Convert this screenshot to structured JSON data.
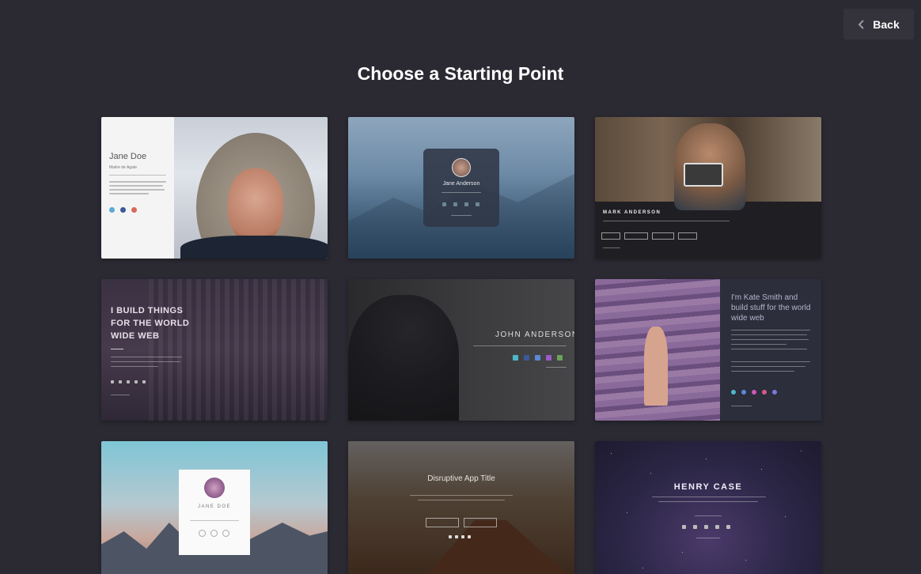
{
  "header": {
    "back_label": "Back",
    "title": "Choose a Starting Point"
  },
  "templates": {
    "t1": {
      "name": "Jane Doe",
      "subtitle": "Maitre de Agate"
    },
    "t2": {
      "name": "Jane Anderson"
    },
    "t3": {
      "name": "MARK ANDERSON"
    },
    "t4": {
      "headline_1": "I BUILD THINGS",
      "headline_2": "FOR THE WORLD",
      "headline_3": "WIDE WEB"
    },
    "t5": {
      "name": "JOHN ANDERSON"
    },
    "t6": {
      "line_1": "I'm Kate Smith and",
      "line_2": "build stuff for the world",
      "line_3": "wide web"
    },
    "t7": {
      "name": "JANE DOE"
    },
    "t8": {
      "title": "Disruptive App Title"
    },
    "t9": {
      "name": "HENRY CASE"
    }
  },
  "colors": {
    "background": "#2b2a33",
    "back_button": "#34333c",
    "text": "#ffffff"
  }
}
